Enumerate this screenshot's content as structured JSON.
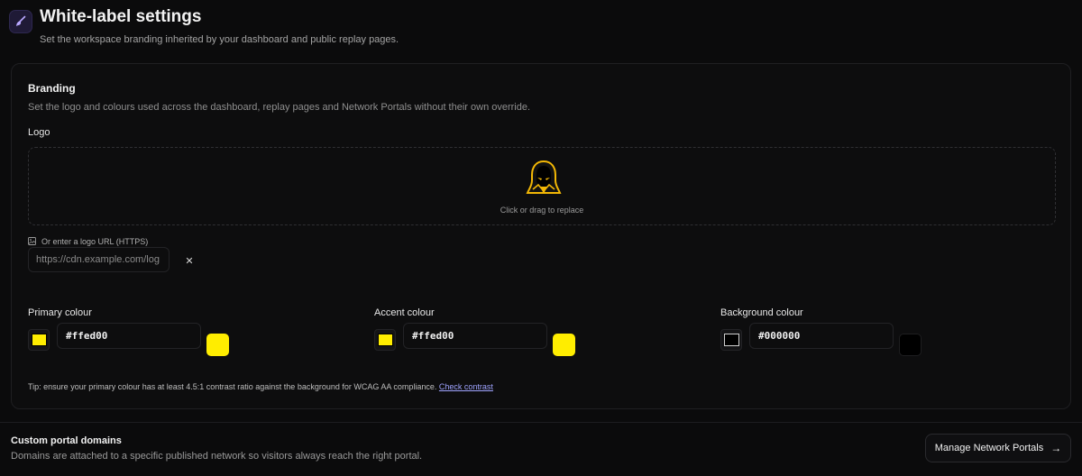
{
  "header": {
    "title": "White-label settings",
    "subtitle": "Set the workspace branding inherited by your dashboard and public replay pages.",
    "icon": "brush-icon"
  },
  "branding": {
    "title": "Branding",
    "description": "Set the logo and colours used across the dashboard, replay pages and Network Portals without their own override.",
    "logo_label": "Logo",
    "dropzone_hint": "Click or drag to replace",
    "url_label": "Or enter a logo URL (HTTPS)",
    "url_value": "https://cdn.example.com/log",
    "clear_symbol": "✕"
  },
  "colors": [
    {
      "label": "Primary colour",
      "value": "#ffed00",
      "swatch": "#ffed00"
    },
    {
      "label": "Accent colour",
      "value": "#ffed00",
      "swatch": "#ffed00"
    },
    {
      "label": "Background colour",
      "value": "#000000",
      "swatch": "#000000"
    }
  ],
  "tip": {
    "text": "Tip: ensure your primary colour has at least 4.5:1 contrast ratio against the background for WCAG AA compliance.",
    "link": "Check contrast"
  },
  "portal": {
    "title": "Custom portal domains",
    "description": "Domains are attached to a specific published network so visitors always reach the right portal.",
    "button_label": "Manage Network Portals",
    "button_icon": "arrow-right-icon"
  },
  "theme": {
    "accent": "#7b61ff",
    "link": "#9fa3ff",
    "background": "#0b0b0c"
  }
}
